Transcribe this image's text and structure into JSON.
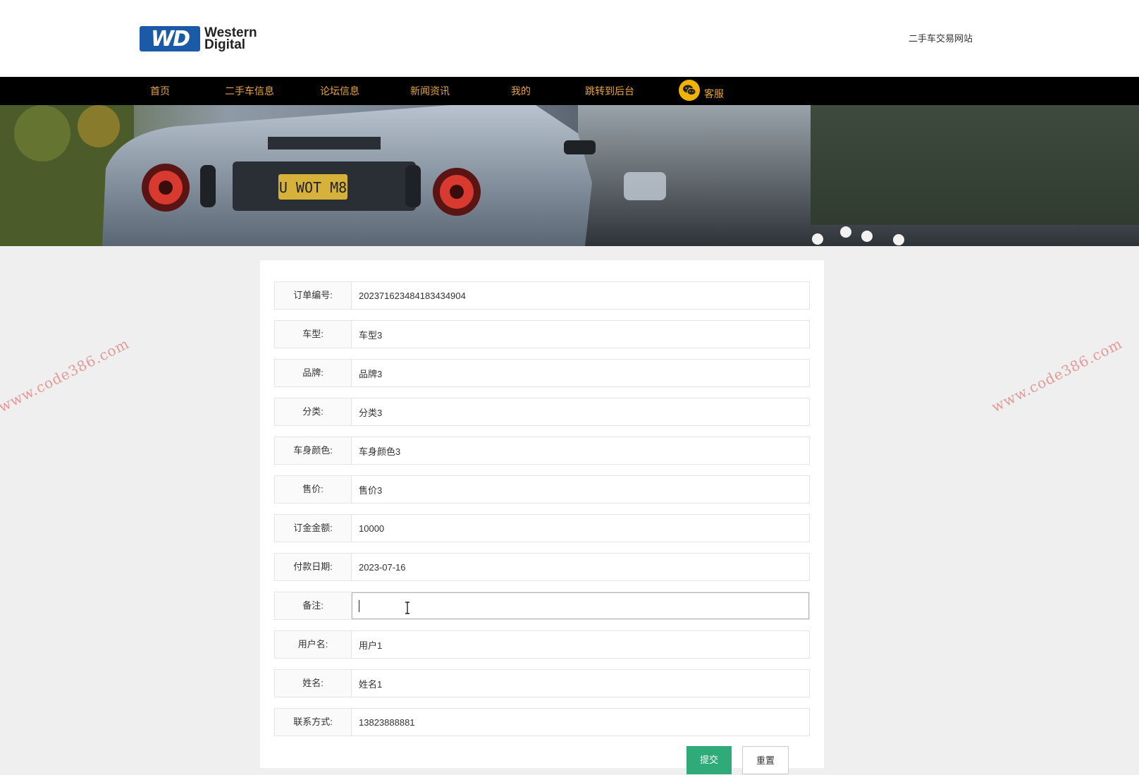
{
  "header": {
    "logo_mark": "WD",
    "logo_line1": "Western",
    "logo_line2": "Digital",
    "site_name": "二手车交易网站"
  },
  "nav": {
    "items": [
      "首页",
      "二手车信息",
      "论坛信息",
      "新闻资讯",
      "我的",
      "跳转到后台"
    ],
    "service_label": "客服",
    "service_icon": "wechat-icon",
    "color": "#e8a53a"
  },
  "banner": {
    "plate_text": "U WOT M8"
  },
  "form": {
    "fields": [
      {
        "label": "订单编号:",
        "value": "202371623484183434904"
      },
      {
        "label": "车型:",
        "value": "车型3"
      },
      {
        "label": "品牌:",
        "value": "品牌3"
      },
      {
        "label": "分类:",
        "value": "分类3"
      },
      {
        "label": "车身颜色:",
        "value": "车身颜色3"
      },
      {
        "label": "售价:",
        "value": "售价3"
      },
      {
        "label": "订金金额:",
        "value": "10000"
      },
      {
        "label": "付款日期:",
        "value": "2023-07-16"
      },
      {
        "label": "备注:",
        "value": ""
      },
      {
        "label": "用户名:",
        "value": "用户1"
      },
      {
        "label": "姓名:",
        "value": "姓名1"
      },
      {
        "label": "联系方式:",
        "value": "13823888881"
      }
    ],
    "submit_label": "提交",
    "reset_label": "重置",
    "submit_color": "#2fab7a"
  },
  "watermark": "www.code386.com"
}
